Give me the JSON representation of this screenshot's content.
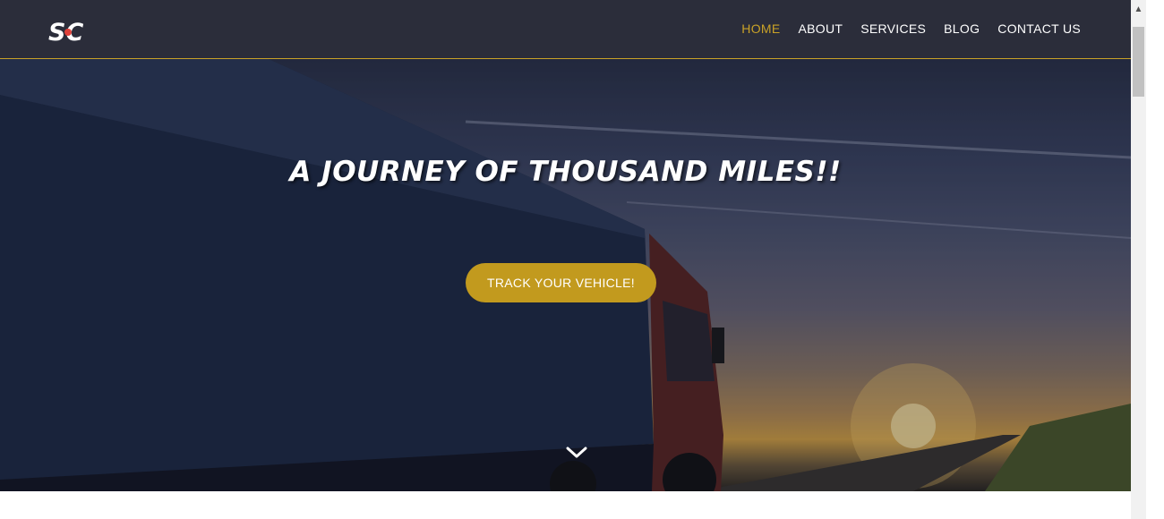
{
  "header": {
    "logo_icon": "sc-logo-icon",
    "nav": [
      {
        "label": "HOME",
        "active": true
      },
      {
        "label": "ABOUT",
        "active": false
      },
      {
        "label": "SERVICES",
        "active": false
      },
      {
        "label": "BLOG",
        "active": false
      },
      {
        "label": "CONTACT US",
        "active": false
      }
    ]
  },
  "hero": {
    "title": "A JOURNEY OF THOUSAND MILES!!",
    "cta_label": "TRACK YOUR VEHICLE!",
    "scroll_icon": "chevron-down-icon"
  },
  "colors": {
    "header_bg": "#2b2d3a",
    "accent": "#c9a227",
    "button": "#c29a1e",
    "text": "#ffffff"
  }
}
